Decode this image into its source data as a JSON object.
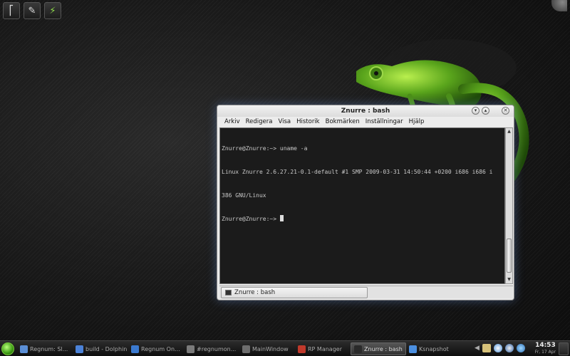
{
  "desktop": {
    "launchers": [
      {
        "icon": "terminal-launcher-icon",
        "glyph": "⎡"
      },
      {
        "icon": "eraser-icon",
        "glyph": "✎"
      },
      {
        "icon": "power-manager-icon",
        "glyph": "⚡"
      }
    ]
  },
  "window": {
    "title": "Znurre : bash",
    "menu": [
      "Arkiv",
      "Redigera",
      "Visa",
      "Historik",
      "Bokmärken",
      "Inställningar",
      "Hjälp"
    ],
    "terminal_lines": [
      "Znurre@Znurre:~> uname -a",
      "Linux Znurre 2.6.27.21-0.1-default #1 SMP 2009-03-31 14:50:44 +0200 i686 i686 i",
      "386 GNU/Linux",
      "Znurre@Znurre:~> "
    ],
    "tab_label": "Znurre : bash"
  },
  "taskbar": {
    "tasks": [
      {
        "label": "Regnum: Sl...",
        "color": "#5b8fd6",
        "active": false
      },
      {
        "label": "build - Dolphin",
        "color": "#4b82d8",
        "active": false
      },
      {
        "label": "Regnum On...",
        "color": "#3b7ad0",
        "active": false
      },
      {
        "label": "#regnumon...",
        "color": "#7a7a7a",
        "active": false
      },
      {
        "label": "MainWindow",
        "color": "#6d6d6d",
        "active": false
      },
      {
        "label": "RP Manager",
        "color": "#c0392b",
        "active": false
      },
      {
        "label": "Znurre : bash",
        "color": "#2a2a2a",
        "active": true
      },
      {
        "label": "Ksnapshot",
        "color": "#4b8fe0",
        "active": false
      }
    ],
    "clock_time": "14:53",
    "clock_date": "Fr, 17 Apr"
  },
  "colors": {
    "terminal_bg": "#1b1b1b",
    "terminal_fg": "#c9c9c9",
    "accent_green": "#7acb3c"
  }
}
